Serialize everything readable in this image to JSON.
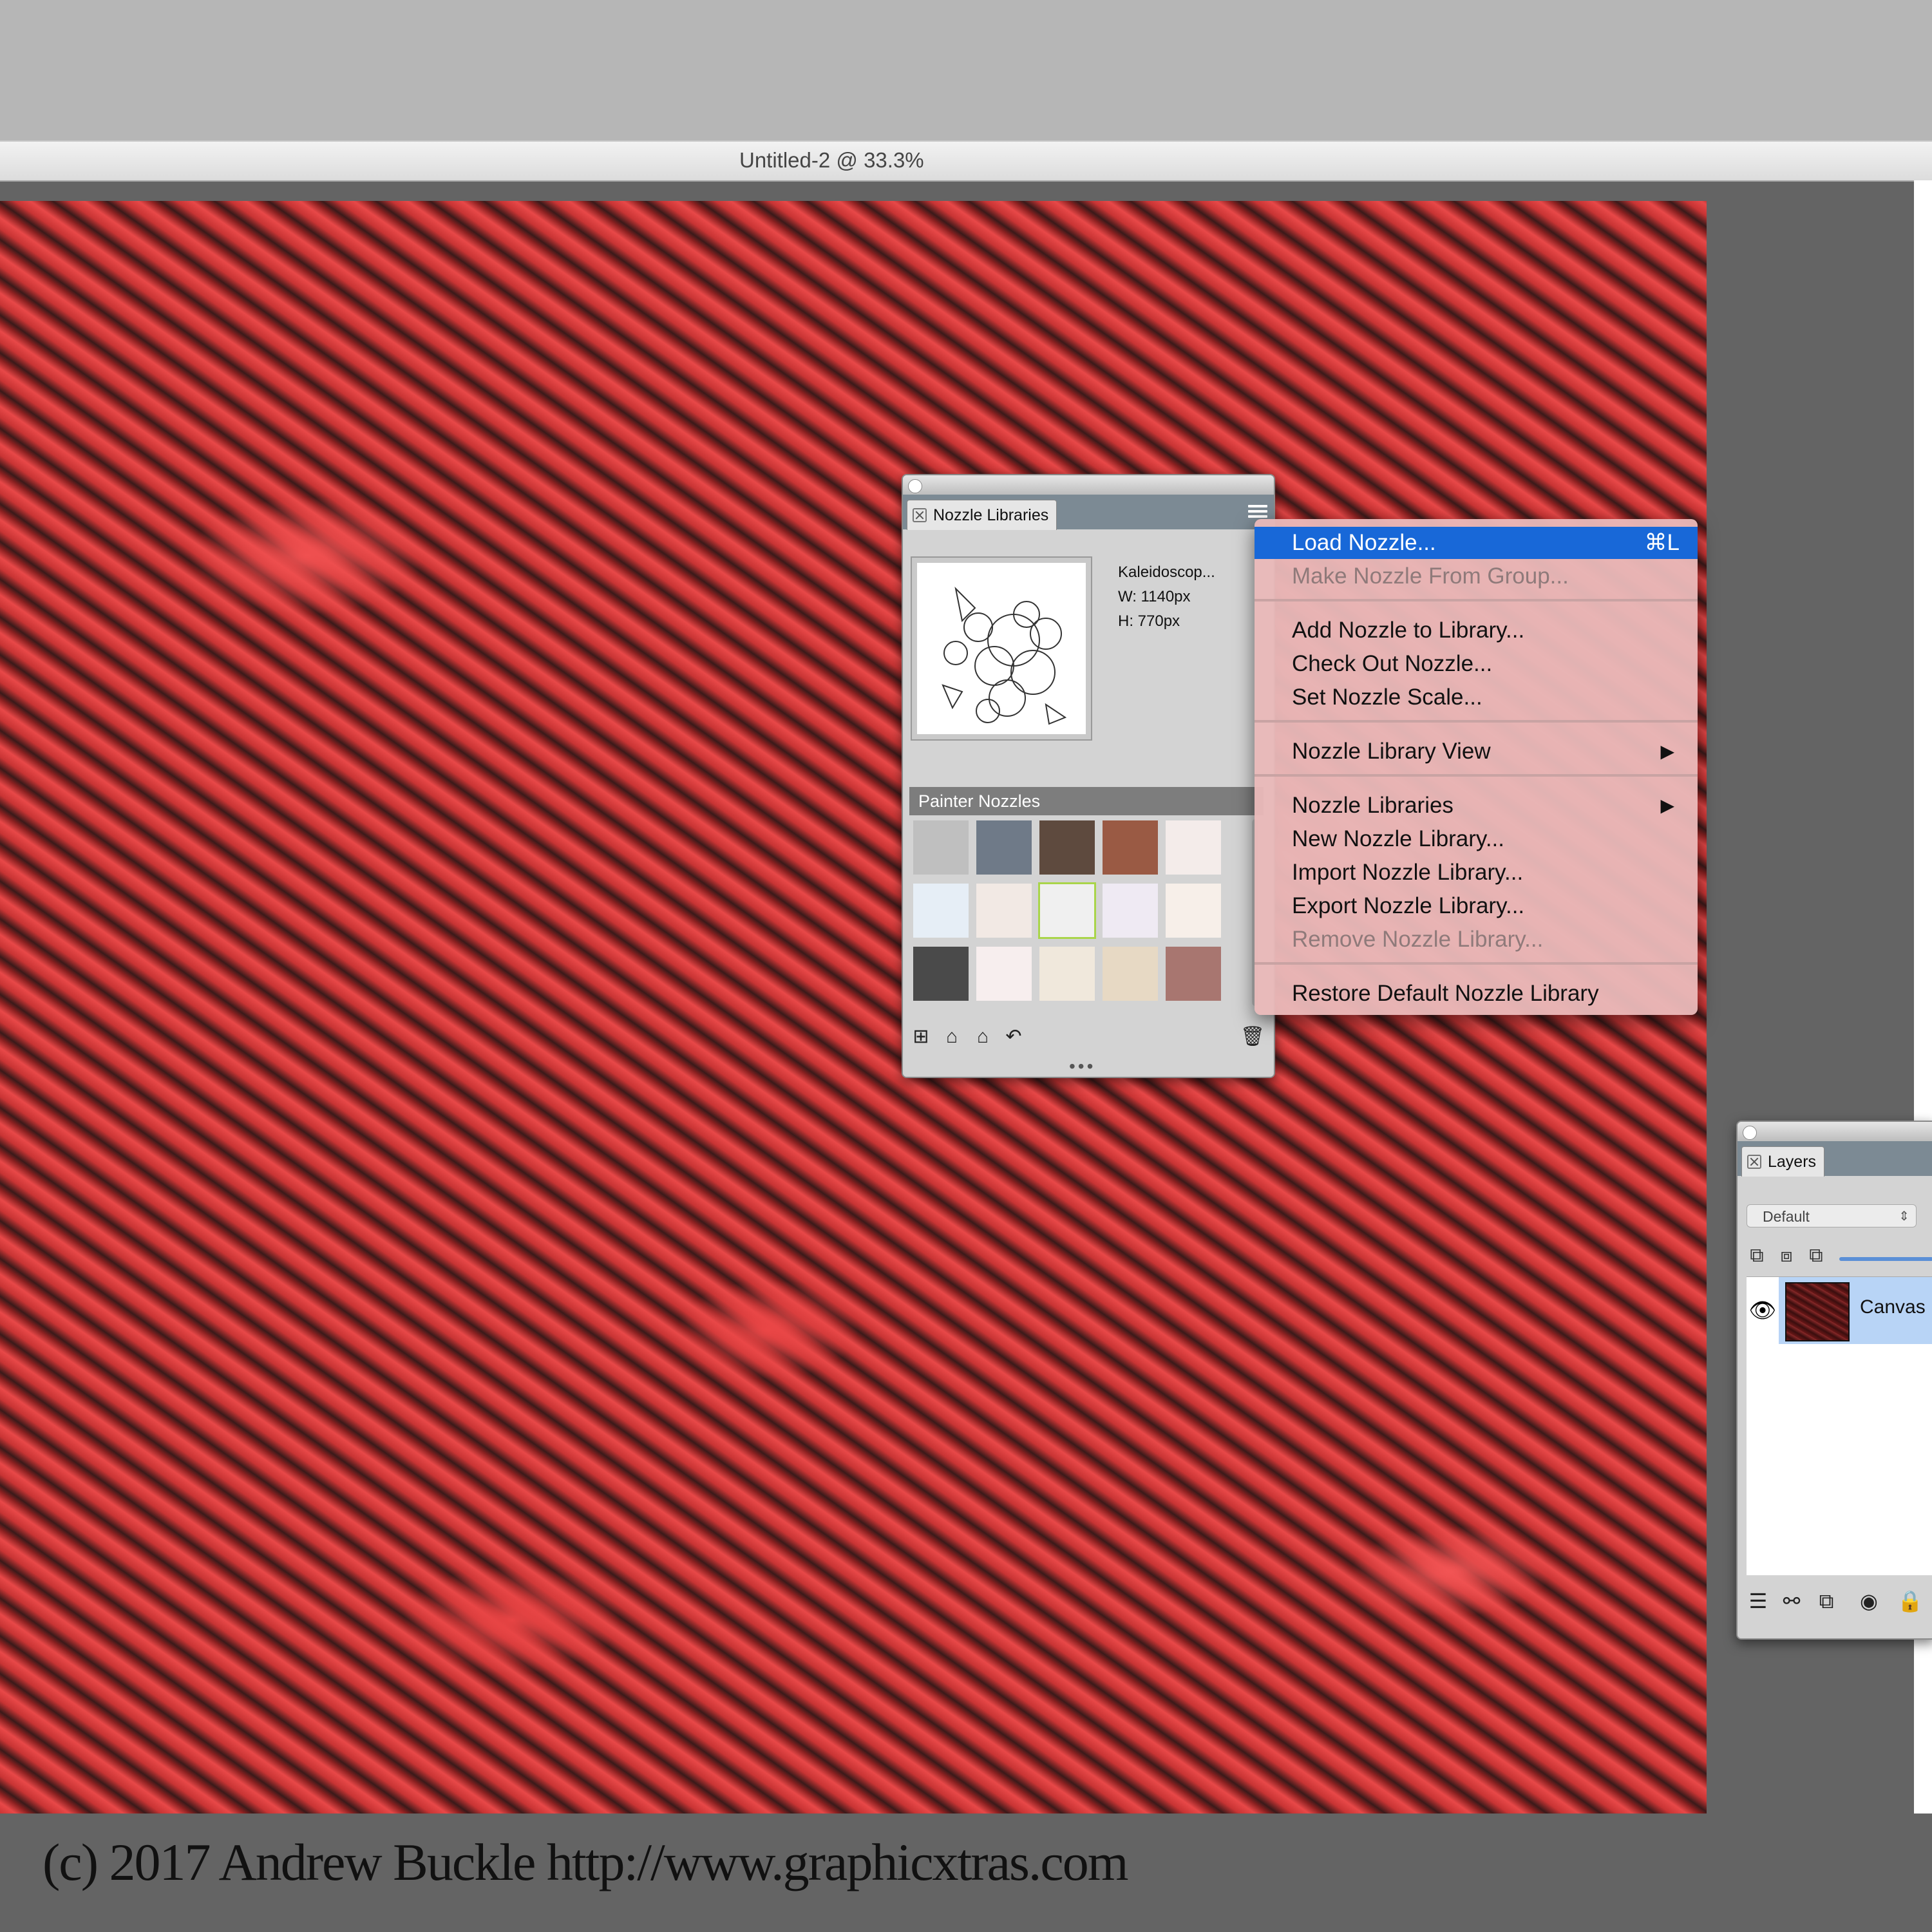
{
  "window": {
    "document_title": "Untitled-2 @ 33.3%"
  },
  "canvas": {
    "description_colors": {
      "base": "#b02a2a",
      "highlight": "#f05050",
      "shadow": "#3a1a1a"
    }
  },
  "copyright": "(c) 2017 Andrew Buckle http://www.graphicxtras.com",
  "nozzle_panel": {
    "tab_label": "Nozzle Libraries",
    "selected_nozzle": {
      "name": "Kaleidoscop...",
      "width": "W: 1140px",
      "height": "H: 770px"
    },
    "library_name": "Painter Nozzles",
    "thumbnails": [
      {
        "color": "#bfbfbf",
        "selected": false
      },
      {
        "color": "#6f7a88",
        "selected": false
      },
      {
        "color": "#5e4a3e",
        "selected": false
      },
      {
        "color": "#9a5a44",
        "selected": false
      },
      {
        "color": "#f4ecea",
        "selected": false
      },
      {
        "color": "#e6eef6",
        "selected": false
      },
      {
        "color": "#f2e9e4",
        "selected": false
      },
      {
        "color": "#f0f0f0",
        "selected": true
      },
      {
        "color": "#efeaf3",
        "selected": false
      },
      {
        "color": "#f7efe9",
        "selected": false
      },
      {
        "color": "#4a4a4a",
        "selected": false
      },
      {
        "color": "#f7eeee",
        "selected": false
      },
      {
        "color": "#f0e8dc",
        "selected": false
      },
      {
        "color": "#e7d9c4",
        "selected": false
      },
      {
        "color": "#a87670",
        "selected": false
      }
    ],
    "footer_icons": [
      "new-library-icon",
      "import-library-icon",
      "export-library-icon",
      "revert-icon",
      "trash-icon"
    ]
  },
  "menu": {
    "accent": "#1868d8",
    "items": [
      {
        "label": "Load Nozzle...",
        "shortcut": "⌘L",
        "state": "highlighted"
      },
      {
        "label": "Make Nozzle From Group...",
        "state": "disabled"
      },
      {
        "label": "Add Nozzle to Library...",
        "state": "enabled"
      },
      {
        "label": "Check Out Nozzle...",
        "state": "enabled"
      },
      {
        "label": "Set Nozzle Scale...",
        "state": "enabled"
      },
      {
        "label": "Nozzle Library View",
        "submenu": true,
        "state": "enabled"
      },
      {
        "label": "Nozzle Libraries",
        "submenu": true,
        "state": "enabled"
      },
      {
        "label": "New Nozzle Library...",
        "state": "enabled"
      },
      {
        "label": "Import Nozzle Library...",
        "state": "enabled"
      },
      {
        "label": "Export Nozzle Library...",
        "state": "enabled"
      },
      {
        "label": "Remove Nozzle Library...",
        "state": "disabled"
      },
      {
        "label": "Restore Default Nozzle Library",
        "state": "enabled"
      }
    ],
    "submenu_arrow": "▶"
  },
  "layers_panel": {
    "tab_label": "Layers",
    "blend_mode": "Default",
    "layers": [
      {
        "name": "Canvas",
        "visible": true,
        "selected": true
      }
    ]
  }
}
